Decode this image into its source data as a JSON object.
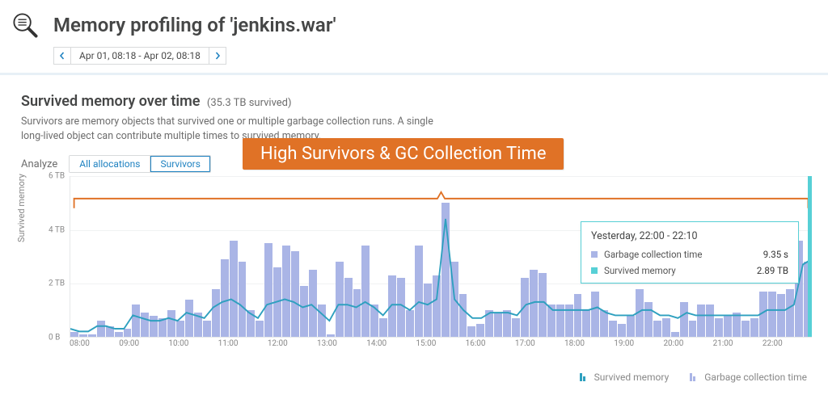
{
  "header": {
    "title": "Memory profiling of 'jenkins.war'",
    "timerange": "Apr 01, 08:18 - Apr 02, 08:18"
  },
  "section": {
    "title": "Survived memory over time",
    "subtitle": "(35.3 TB survived)",
    "description_l1": "Survivors are memory objects that survived one or multiple garbage collection runs. A single",
    "description_l2": "long-lived object can contribute multiple times to survived memory.",
    "analyze_label": "Analyze",
    "tab_all": "All allocations",
    "tab_surv": "Survivors",
    "callout": "High Survivors & GC Collection Time"
  },
  "chart_data": {
    "type": "bar+line",
    "ylabel": "Survived memory",
    "ylim": [
      0,
      6
    ],
    "yticks": [
      "0 B",
      "2 TB",
      "4 TB",
      "6 TB"
    ],
    "x_hours": [
      "08:00",
      "09:00",
      "10:00",
      "11:00",
      "12:00",
      "13:00",
      "14:00",
      "15:00",
      "16:00",
      "17:00",
      "18:00",
      "19:00",
      "20:00",
      "21:00",
      "22:00"
    ],
    "series": [
      {
        "name": "Garbage collection time",
        "unit": "s (relative height)",
        "values": [
          0.2,
          0.1,
          0.1,
          0.6,
          0.4,
          0.2,
          0.3,
          1.2,
          0.9,
          0.8,
          0.7,
          1.0,
          0.6,
          1.4,
          0.9,
          0.6,
          1.8,
          2.9,
          3.6,
          2.8,
          1.0,
          0.6,
          3.5,
          2.6,
          3.4,
          3.2,
          1.9,
          2.5,
          1.2,
          0.1,
          2.8,
          2.2,
          1.8,
          3.4,
          1.2,
          0.7,
          2.3,
          2.2,
          1.0,
          3.4,
          2.0,
          2.3,
          5.0,
          2.8,
          1.6,
          0.4,
          0.5,
          1.0,
          0.9,
          1.0,
          0.7,
          2.2,
          2.5,
          2.4,
          1.2,
          1.2,
          1.2,
          1.6,
          1.0,
          1.7,
          1.0,
          0.6,
          0.5,
          0.8,
          1.8,
          1.3,
          0.6,
          0.7,
          0.2,
          1.3,
          0.6,
          1.2,
          1.2,
          0.7,
          0.8,
          0.9,
          0.6,
          0.7,
          1.7,
          1.7,
          1.6,
          1.8,
          3.6,
          2.8
        ]
      },
      {
        "name": "Survived memory",
        "unit": "TB",
        "values": [
          0.3,
          0.2,
          0.2,
          0.4,
          0.4,
          0.3,
          0.3,
          0.8,
          0.7,
          0.6,
          0.6,
          0.7,
          0.6,
          0.9,
          0.8,
          0.7,
          1.1,
          1.3,
          1.4,
          1.2,
          0.9,
          0.7,
          1.2,
          1.3,
          1.4,
          1.3,
          1.1,
          1.2,
          0.9,
          0.6,
          1.2,
          1.2,
          1.1,
          1.3,
          1.1,
          0.8,
          1.2,
          1.2,
          1.0,
          1.3,
          1.2,
          1.4,
          4.4,
          1.4,
          1.0,
          0.7,
          0.7,
          0.9,
          0.9,
          0.9,
          0.8,
          1.2,
          1.3,
          1.3,
          1.0,
          1.0,
          1.0,
          1.0,
          1.0,
          1.1,
          0.9,
          0.8,
          0.8,
          0.8,
          1.0,
          1.0,
          0.8,
          0.8,
          0.7,
          0.9,
          0.8,
          0.8,
          0.8,
          0.8,
          0.8,
          0.8,
          0.8,
          0.8,
          1.0,
          1.0,
          1.0,
          1.2,
          2.7,
          2.9
        ]
      }
    ]
  },
  "tooltip": {
    "title": "Yesterday, 22:00 - 22:10",
    "rows": [
      {
        "label": "Garbage collection time",
        "value": "9.35 s",
        "color": "#aab5e6"
      },
      {
        "label": "Survived memory",
        "value": "2.89 TB",
        "color": "#57d0d6"
      }
    ]
  },
  "legend": {
    "a": "Survived memory",
    "b": "Garbage collection time"
  }
}
